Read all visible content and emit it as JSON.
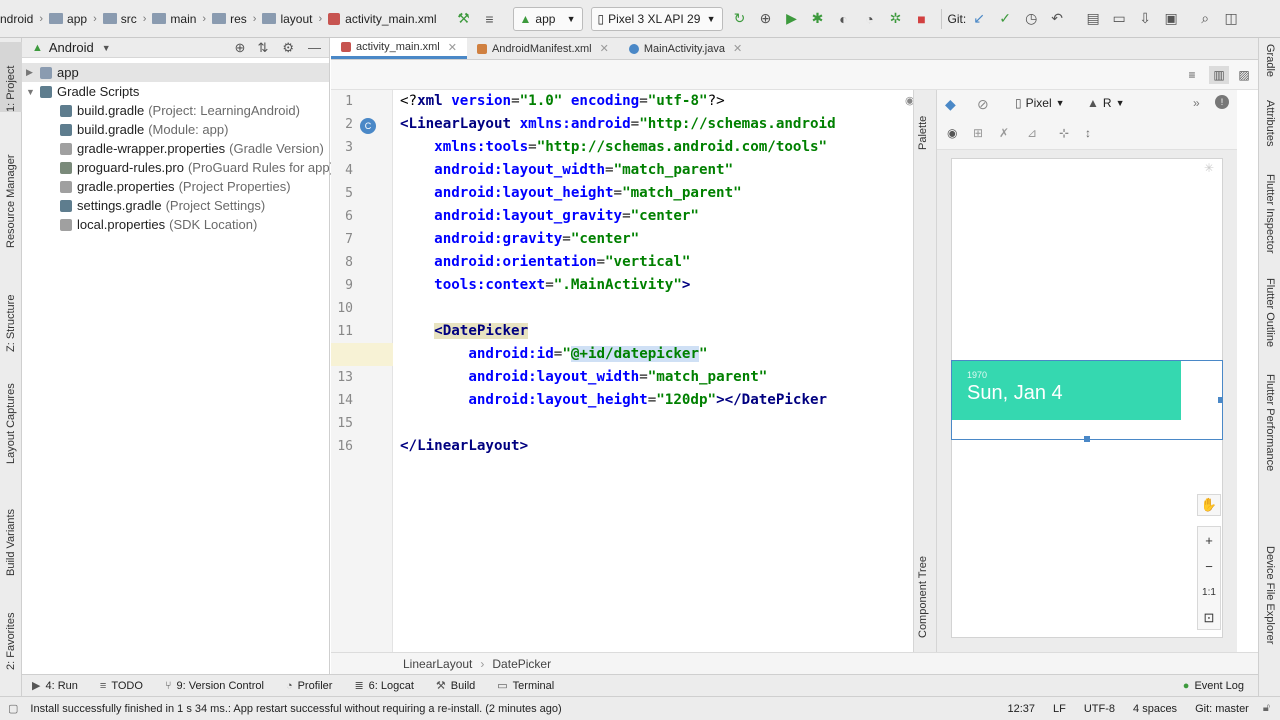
{
  "topbar": {
    "crumbs": [
      "ndroid",
      "app",
      "src",
      "main",
      "res",
      "layout",
      "activity_main.xml"
    ],
    "run_config": "app",
    "device": "Pixel 3 XL API 29",
    "git_label": "Git:"
  },
  "project_panel": {
    "view_mode": "Android",
    "tree": [
      {
        "label": "app",
        "sub": "",
        "kind": "folder"
      },
      {
        "label": "Gradle Scripts",
        "sub": "",
        "kind": "gradle-group"
      },
      {
        "label": "build.gradle",
        "sub": "(Project: LearningAndroid)",
        "kind": "gradle"
      },
      {
        "label": "build.gradle",
        "sub": "(Module: app)",
        "kind": "gradle"
      },
      {
        "label": "gradle-wrapper.properties",
        "sub": "(Gradle Version)",
        "kind": "props"
      },
      {
        "label": "proguard-rules.pro",
        "sub": "(ProGuard Rules for app)",
        "kind": "pro"
      },
      {
        "label": "gradle.properties",
        "sub": "(Project Properties)",
        "kind": "props"
      },
      {
        "label": "settings.gradle",
        "sub": "(Project Settings)",
        "kind": "gradle"
      },
      {
        "label": "local.properties",
        "sub": "(SDK Location)",
        "kind": "props"
      }
    ]
  },
  "left_strip": {
    "project": "1: Project",
    "resource_manager": "Resource Manager",
    "structure": "Z: Structure",
    "layout_captures": "Layout Captures",
    "build_variants": "Build Variants",
    "favorites": "2: Favorites"
  },
  "right_strip": {
    "gradle": "Gradle",
    "attributes": "Attributes",
    "flutter_inspector": "Flutter Inspector",
    "flutter_outline": "Flutter Outline",
    "flutter_performance": "Flutter Performance",
    "device_file_explorer": "Device File Explorer"
  },
  "editor_tabs": [
    {
      "label": "activity_main.xml",
      "active": true
    },
    {
      "label": "AndroidManifest.xml",
      "active": false
    },
    {
      "label": "MainActivity.java",
      "active": false
    }
  ],
  "code_lines": [
    "<?xml version=\"1.0\" encoding=\"utf-8\"?>",
    "<LinearLayout xmlns:android=\"http://schemas.android",
    "    xmlns:tools=\"http://schemas.android.com/tools\"",
    "    android:layout_width=\"match_parent\"",
    "    android:layout_height=\"match_parent\"",
    "    android:layout_gravity=\"center\"",
    "    android:gravity=\"center\"",
    "    android:orientation=\"vertical\"",
    "    tools:context=\".MainActivity\">",
    "",
    "    <DatePicker",
    "        android:id=\"@+id/datepicker\"",
    "        android:layout_width=\"match_parent\"",
    "        android:layout_height=\"120dp\"></DatePicker",
    "",
    "</LinearLayout>"
  ],
  "design": {
    "palette": "Palette",
    "component_tree": "Component Tree",
    "device": "Pixel",
    "api": "R",
    "zoom_ratio": "1:1",
    "datepicker_year": "1970",
    "datepicker_date": "Sun, Jan 4"
  },
  "breadcrumb": [
    "LinearLayout",
    "DatePicker"
  ],
  "tool_windows": [
    "4: Run",
    "TODO",
    "9: Version Control",
    "Profiler",
    "6: Logcat",
    "Build",
    "Terminal"
  ],
  "event_log": "Event Log",
  "status": {
    "message": "Install successfully finished in 1 s 34 ms.: App restart successful without requiring a re-install. (2 minutes ago)",
    "position": "12:37",
    "line_sep": "LF",
    "encoding": "UTF-8",
    "indent": "4 spaces",
    "git": "Git: master"
  },
  "colors": {
    "accent": "#4a88c7",
    "datepicker": "#35d8b0",
    "highlight": "#fdf7d2",
    "change_marker": "#e4bb00"
  }
}
